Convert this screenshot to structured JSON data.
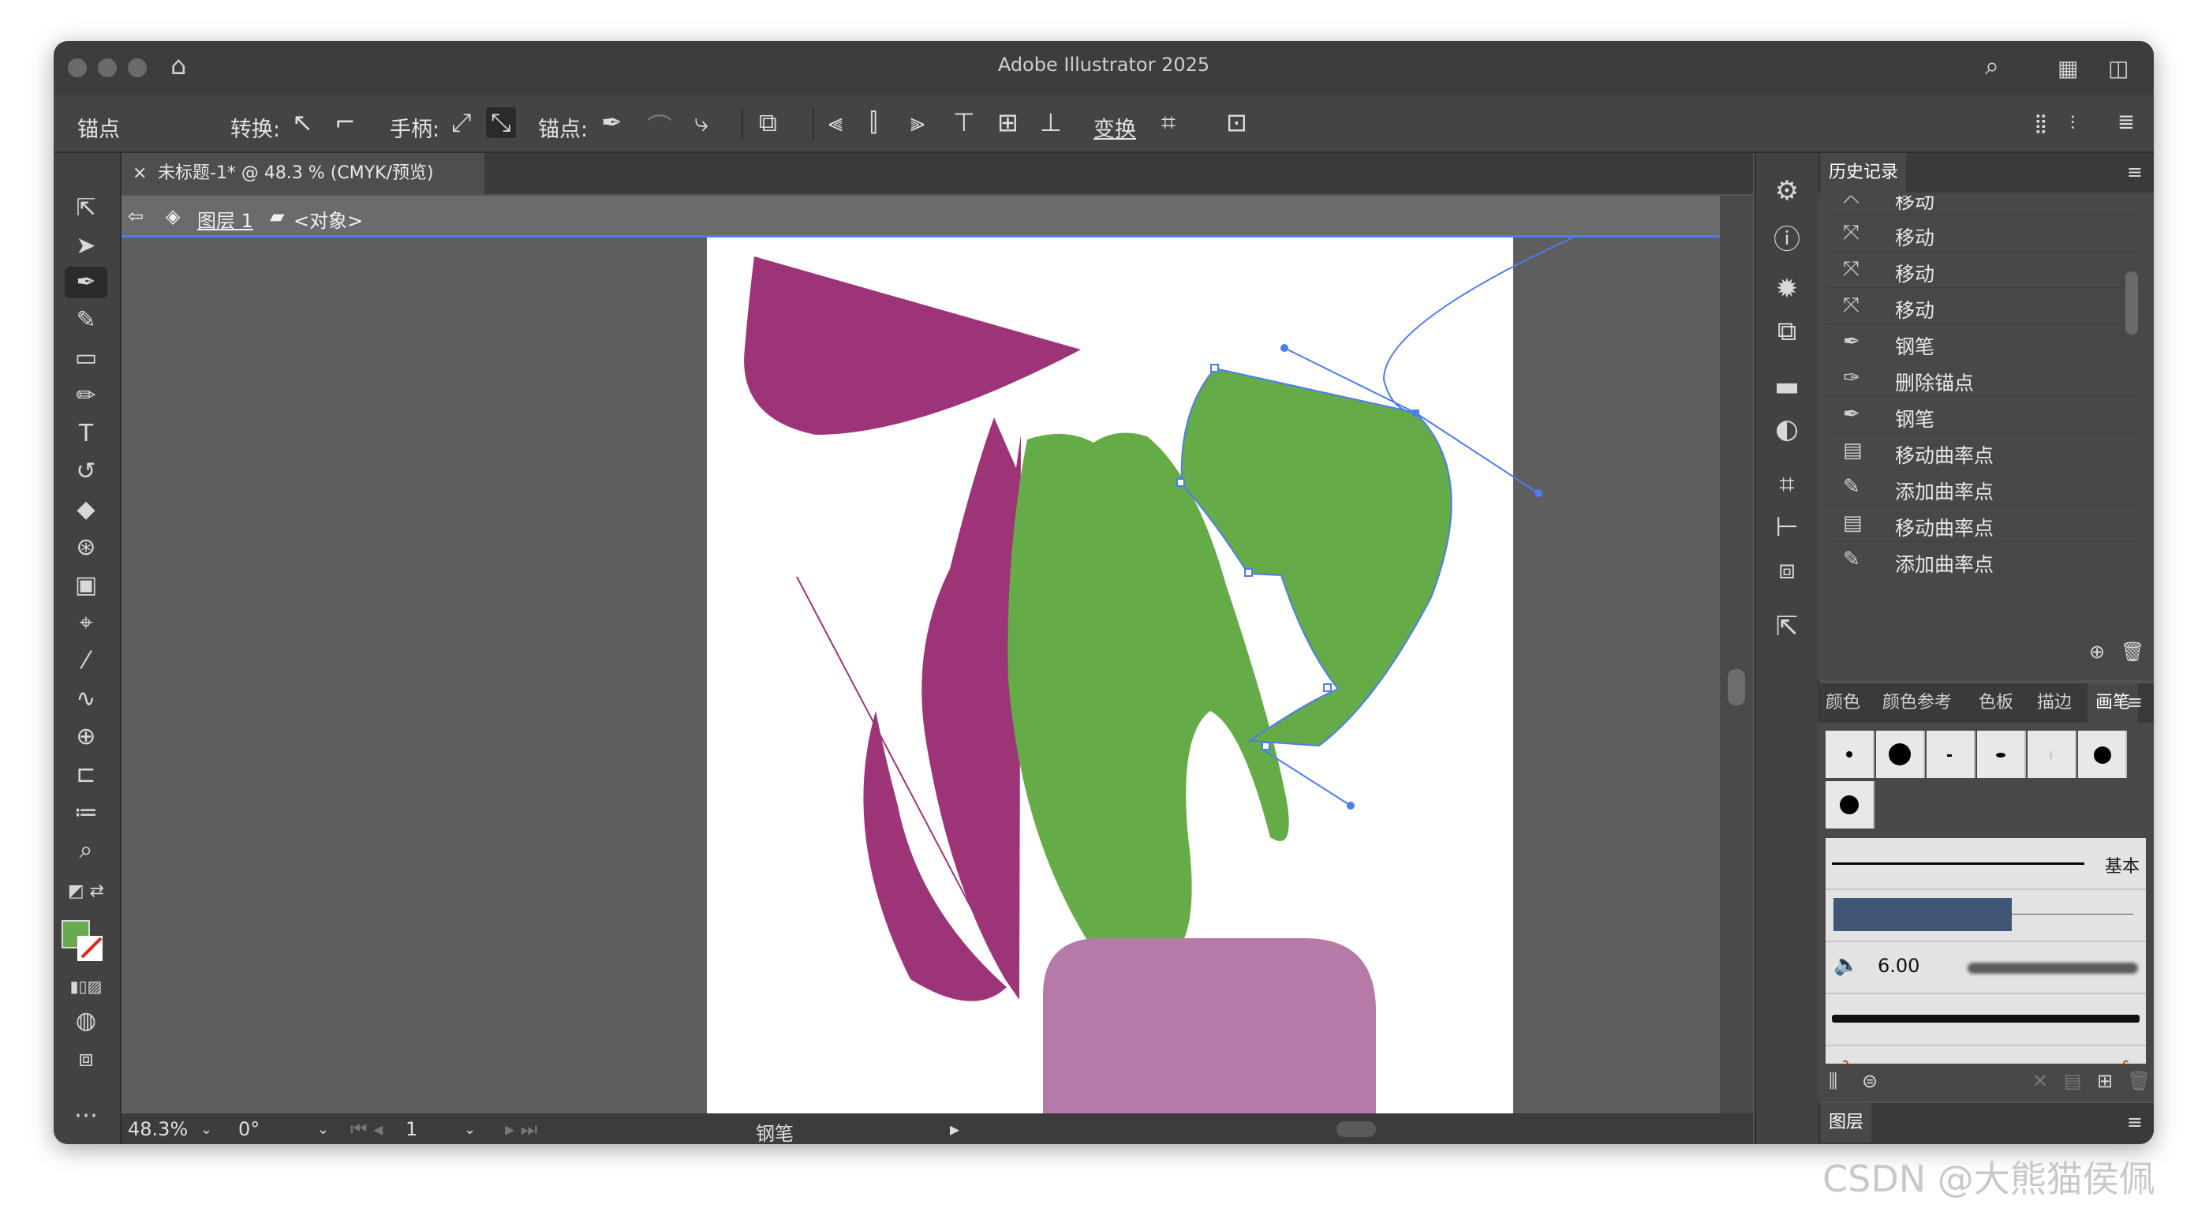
{
  "window": {
    "title": "Adobe Illustrator 2025"
  },
  "control_bar": {
    "anchor_label": "锚点",
    "convert_label": "转换:",
    "handles_label": "手柄:",
    "anchors_label": "锚点:",
    "transform_label": "变换"
  },
  "document": {
    "tab_close": "×",
    "tab_title": "未标题-1* @ 48.3 % (CMYK/预览)",
    "breadcrumb_layer": "图层 1",
    "breadcrumb_object": "<对象>"
  },
  "status_bar": {
    "zoom": "48.3%",
    "rotation": "0°",
    "artboard": "1",
    "current_tool": "钢笔"
  },
  "history_panel": {
    "title": "历史记录",
    "items": [
      {
        "label": "移动",
        "icon": "move-icon"
      },
      {
        "label": "移动",
        "icon": "move-icon"
      },
      {
        "label": "移动",
        "icon": "move-icon"
      },
      {
        "label": "移动",
        "icon": "move-icon"
      },
      {
        "label": "钢笔",
        "icon": "pen-icon"
      },
      {
        "label": "删除锚点",
        "icon": "delete-anchor-icon"
      },
      {
        "label": "钢笔",
        "icon": "pen-icon"
      },
      {
        "label": "移动曲率点",
        "icon": "document-icon"
      },
      {
        "label": "添加曲率点",
        "icon": "add-anchor-icon"
      },
      {
        "label": "移动曲率点",
        "icon": "document-icon"
      },
      {
        "label": "添加曲率点",
        "icon": "add-anchor-icon"
      }
    ]
  },
  "color_panel_tabs": [
    "颜色",
    "颜色参考",
    "色板",
    "描边",
    "画笔"
  ],
  "brushes_panel": {
    "active_tab": "画笔",
    "basic_label": "基本",
    "calligraphic_size": "6.00"
  },
  "layers_panel": {
    "title": "图层"
  },
  "fill_color": "#6aaa4f",
  "shape_colors": {
    "magenta": "#9d3478",
    "green": "#65ab48",
    "pink": "#b57aa7",
    "selection": "#4b7cf0"
  },
  "watermark": "CSDN @大熊猫侯佩"
}
